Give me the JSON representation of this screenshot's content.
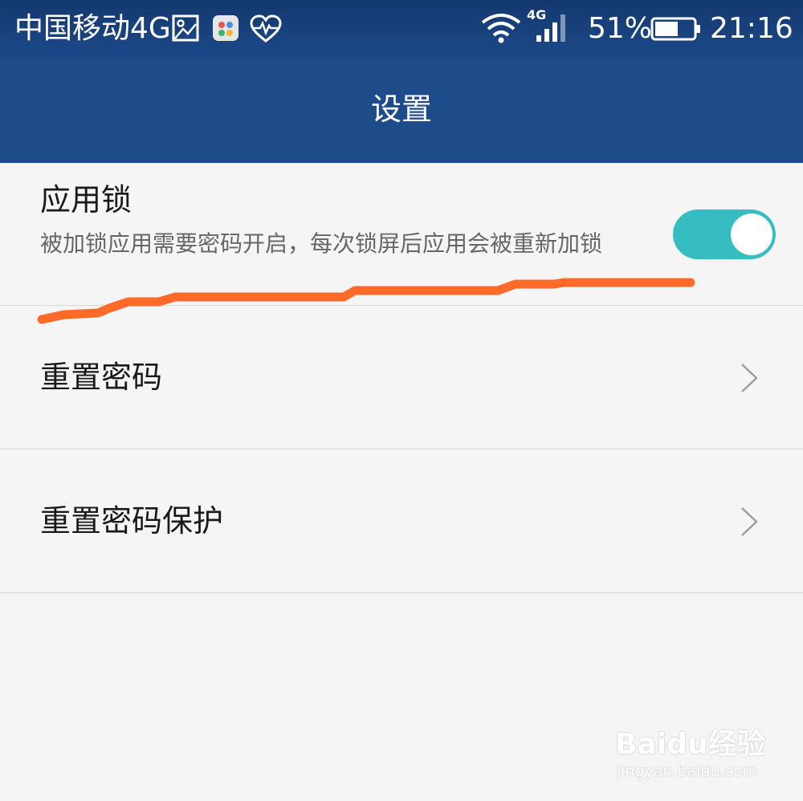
{
  "status_bar": {
    "carrier": "中国移动4G",
    "network_type": "4G",
    "battery_percent": "51%",
    "time": "21:16",
    "icons": [
      "photo-icon",
      "app-icon",
      "heart-monitor-icon",
      "wifi-icon",
      "signal-icon",
      "battery-icon"
    ]
  },
  "header": {
    "title": "设置"
  },
  "settings": {
    "app_lock": {
      "title": "应用锁",
      "description": "被加锁应用需要密码开启，每次锁屏后应用会被重新加锁",
      "enabled": true
    },
    "reset_password": {
      "title": "重置密码"
    },
    "reset_password_protection": {
      "title": "重置密码保护"
    }
  },
  "watermark": {
    "logo": "Baidu经验",
    "url": "jingyan.baidu.com"
  },
  "colors": {
    "header_bg": "#1e4c8b",
    "toggle_on": "#35bdc2",
    "annotation": "#ff6a2b",
    "page_bg": "#f5f5f5"
  }
}
